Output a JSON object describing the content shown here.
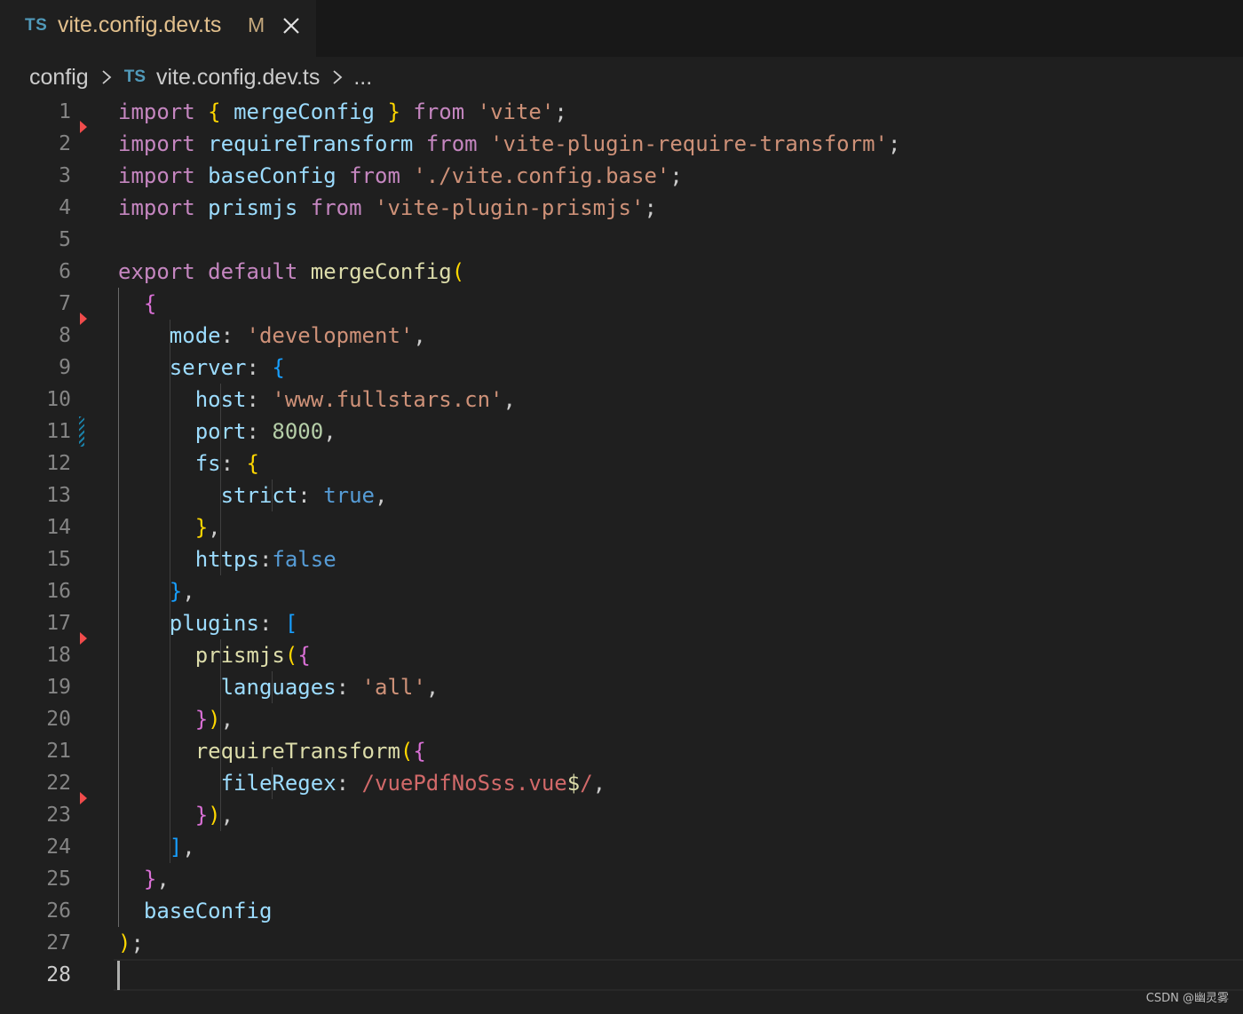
{
  "tab": {
    "language_badge": "TS",
    "title": "vite.config.dev.ts",
    "modified_marker": "M",
    "close_icon": "close-icon"
  },
  "breadcrumb": {
    "folder": "config",
    "file_badge": "TS",
    "file": "vite.config.dev.ts",
    "ellipsis": "..."
  },
  "editor": {
    "active_line": 28,
    "lines": [
      {
        "n": "1",
        "tokens": [
          [
            "kw",
            "import"
          ],
          [
            "pl",
            " "
          ],
          [
            "b1",
            "{"
          ],
          [
            "pl",
            " "
          ],
          [
            "vr",
            "mergeConfig"
          ],
          [
            "pl",
            " "
          ],
          [
            "b1",
            "}"
          ],
          [
            "pl",
            " "
          ],
          [
            "kw",
            "from"
          ],
          [
            "pl",
            " "
          ],
          [
            "st",
            "'vite'"
          ],
          [
            "pl",
            ";"
          ]
        ]
      },
      {
        "n": "2",
        "tokens": [
          [
            "kw",
            "import"
          ],
          [
            "pl",
            " "
          ],
          [
            "vr",
            "requireTransform"
          ],
          [
            "pl",
            " "
          ],
          [
            "kw",
            "from"
          ],
          [
            "pl",
            " "
          ],
          [
            "st",
            "'vite-plugin-require-transform'"
          ],
          [
            "pl",
            ";"
          ]
        ]
      },
      {
        "n": "3",
        "tokens": [
          [
            "kw",
            "import"
          ],
          [
            "pl",
            " "
          ],
          [
            "vr",
            "baseConfig"
          ],
          [
            "pl",
            " "
          ],
          [
            "kw",
            "from"
          ],
          [
            "pl",
            " "
          ],
          [
            "st",
            "'./vite.config.base'"
          ],
          [
            "pl",
            ";"
          ]
        ]
      },
      {
        "n": "4",
        "tokens": [
          [
            "kw",
            "import"
          ],
          [
            "pl",
            " "
          ],
          [
            "vr",
            "prismjs"
          ],
          [
            "pl",
            " "
          ],
          [
            "kw",
            "from"
          ],
          [
            "pl",
            " "
          ],
          [
            "st",
            "'vite-plugin-prismjs'"
          ],
          [
            "pl",
            ";"
          ]
        ]
      },
      {
        "n": "5",
        "tokens": []
      },
      {
        "n": "6",
        "tokens": [
          [
            "kw",
            "export"
          ],
          [
            "pl",
            " "
          ],
          [
            "kw",
            "default"
          ],
          [
            "pl",
            " "
          ],
          [
            "fn",
            "mergeConfig"
          ],
          [
            "b1",
            "("
          ]
        ]
      },
      {
        "n": "7",
        "tokens": [
          [
            "pl",
            "  "
          ],
          [
            "b2",
            "{"
          ]
        ]
      },
      {
        "n": "8",
        "tokens": [
          [
            "pl",
            "    "
          ],
          [
            "vr",
            "mode"
          ],
          [
            "pl",
            ": "
          ],
          [
            "st",
            "'development'"
          ],
          [
            "pl",
            ","
          ]
        ]
      },
      {
        "n": "9",
        "tokens": [
          [
            "pl",
            "    "
          ],
          [
            "vr",
            "server"
          ],
          [
            "pl",
            ": "
          ],
          [
            "b3",
            "{"
          ]
        ]
      },
      {
        "n": "10",
        "tokens": [
          [
            "pl",
            "      "
          ],
          [
            "vr",
            "host"
          ],
          [
            "pl",
            ": "
          ],
          [
            "st",
            "'www.fullstars.cn'"
          ],
          [
            "pl",
            ","
          ]
        ]
      },
      {
        "n": "11",
        "tokens": [
          [
            "pl",
            "      "
          ],
          [
            "vr",
            "port"
          ],
          [
            "pl",
            ": "
          ],
          [
            "nm",
            "8000"
          ],
          [
            "pl",
            ","
          ]
        ]
      },
      {
        "n": "12",
        "tokens": [
          [
            "pl",
            "      "
          ],
          [
            "vr",
            "fs"
          ],
          [
            "pl",
            ": "
          ],
          [
            "b1",
            "{"
          ]
        ]
      },
      {
        "n": "13",
        "tokens": [
          [
            "pl",
            "        "
          ],
          [
            "vr",
            "strict"
          ],
          [
            "pl",
            ": "
          ],
          [
            "bl",
            "true"
          ],
          [
            "pl",
            ","
          ]
        ]
      },
      {
        "n": "14",
        "tokens": [
          [
            "pl",
            "      "
          ],
          [
            "b1",
            "}"
          ],
          [
            "pl",
            ","
          ]
        ]
      },
      {
        "n": "15",
        "tokens": [
          [
            "pl",
            "      "
          ],
          [
            "vr",
            "https"
          ],
          [
            "pl",
            ":"
          ],
          [
            "bl",
            "false"
          ]
        ]
      },
      {
        "n": "16",
        "tokens": [
          [
            "pl",
            "    "
          ],
          [
            "b3",
            "}"
          ],
          [
            "pl",
            ","
          ]
        ]
      },
      {
        "n": "17",
        "tokens": [
          [
            "pl",
            "    "
          ],
          [
            "vr",
            "plugins"
          ],
          [
            "pl",
            ": "
          ],
          [
            "b3",
            "["
          ]
        ]
      },
      {
        "n": "18",
        "tokens": [
          [
            "pl",
            "      "
          ],
          [
            "fn",
            "prismjs"
          ],
          [
            "b1",
            "("
          ],
          [
            "b2",
            "{"
          ]
        ]
      },
      {
        "n": "19",
        "tokens": [
          [
            "pl",
            "        "
          ],
          [
            "vr",
            "languages"
          ],
          [
            "pl",
            ": "
          ],
          [
            "st",
            "'all'"
          ],
          [
            "pl",
            ","
          ]
        ]
      },
      {
        "n": "20",
        "tokens": [
          [
            "pl",
            "      "
          ],
          [
            "b2",
            "}"
          ],
          [
            "b1",
            ")"
          ],
          [
            "pl",
            ","
          ]
        ]
      },
      {
        "n": "21",
        "tokens": [
          [
            "pl",
            "      "
          ],
          [
            "fn",
            "requireTransform"
          ],
          [
            "b1",
            "("
          ],
          [
            "b2",
            "{"
          ]
        ]
      },
      {
        "n": "22",
        "tokens": [
          [
            "pl",
            "        "
          ],
          [
            "vr",
            "fileRegex"
          ],
          [
            "pl",
            ": "
          ],
          [
            "rx",
            "/vuePdfNoSss.vue"
          ],
          [
            "fn",
            "$"
          ],
          [
            "rx",
            "/"
          ],
          [
            "pl",
            ","
          ]
        ]
      },
      {
        "n": "23",
        "tokens": [
          [
            "pl",
            "      "
          ],
          [
            "b2",
            "}"
          ],
          [
            "b1",
            ")"
          ],
          [
            "pl",
            ","
          ]
        ]
      },
      {
        "n": "24",
        "tokens": [
          [
            "pl",
            "    "
          ],
          [
            "b3",
            "]"
          ],
          [
            "pl",
            ","
          ]
        ]
      },
      {
        "n": "25",
        "tokens": [
          [
            "pl",
            "  "
          ],
          [
            "b2",
            "}"
          ],
          [
            "pl",
            ","
          ]
        ]
      },
      {
        "n": "26",
        "tokens": [
          [
            "pl",
            "  "
          ],
          [
            "vr",
            "baseConfig"
          ]
        ]
      },
      {
        "n": "27",
        "tokens": [
          [
            "b1",
            ")"
          ],
          [
            "pl",
            ";"
          ]
        ]
      },
      {
        "n": "28",
        "tokens": []
      }
    ]
  },
  "gutter": {
    "deleted_after_lines": [
      1,
      7,
      17,
      22
    ],
    "modified_lines": [
      11
    ]
  },
  "colors": {
    "background": "#1f1f1f",
    "keyword": "#c586c0",
    "string": "#ce9178",
    "function": "#dcdcaa",
    "variable": "#9cdcfe",
    "number": "#b5cea8",
    "boolean": "#569cd6",
    "regex": "#d16969",
    "bracket_1": "#ffd700",
    "bracket_2": "#da70d6",
    "bracket_3": "#179fff",
    "modified_tab": "#e2c08d",
    "ts_badge": "#519aba"
  },
  "watermark": "CSDN @幽灵雾"
}
